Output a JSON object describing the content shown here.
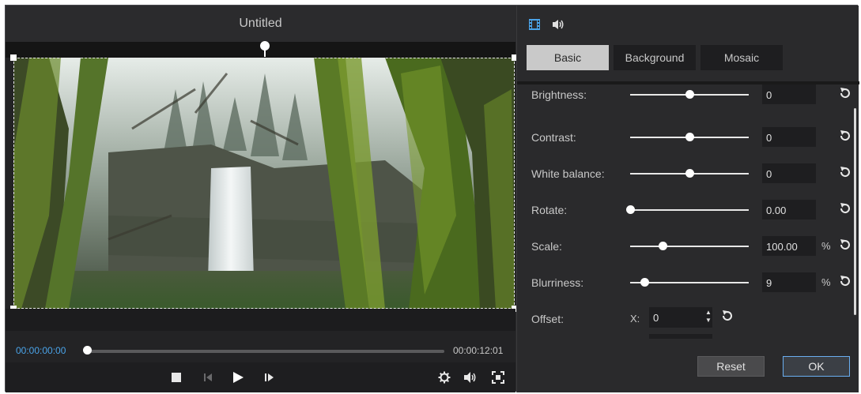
{
  "window": {
    "title": "Untitled"
  },
  "player": {
    "time_current": "00:00:00:00",
    "time_total": "00:00:12:01",
    "progress": 0
  },
  "controls": {
    "left_icons": [
      "stop-icon",
      "previous-frame-icon",
      "play-icon",
      "next-frame-icon"
    ],
    "right_icons": [
      "settings-gear-icon",
      "volume-icon",
      "snapshot-icon"
    ]
  },
  "panel": {
    "mode_icons": [
      "video-film-icon",
      "audio-speaker-icon"
    ],
    "tabs": [
      {
        "label": "Basic",
        "active": true
      },
      {
        "label": "Background",
        "active": false
      },
      {
        "label": "Mosaic",
        "active": false
      }
    ],
    "settings": [
      {
        "label": "Brightness:",
        "value": "0",
        "unit": "",
        "slider": 0.5
      },
      {
        "label": "Contrast:",
        "value": "0",
        "unit": "",
        "slider": 0.5
      },
      {
        "label": "White balance:",
        "value": "0",
        "unit": "",
        "slider": 0.5
      },
      {
        "label": "Rotate:",
        "value": "0.00",
        "unit": "",
        "slider": 0.0
      },
      {
        "label": "Scale:",
        "value": "100.00",
        "unit": "%",
        "slider": 0.27
      },
      {
        "label": "Blurriness:",
        "value": "9",
        "unit": "%",
        "slider": 0.12
      }
    ],
    "offset": {
      "label": "Offset:",
      "x_label": "X:",
      "x_value": "0"
    }
  },
  "buttons": {
    "reset": "Reset",
    "ok": "OK"
  },
  "colors": {
    "accent": "#4aa3e8",
    "panel_bg": "#2a2a2c",
    "player_bg": "#232325"
  }
}
